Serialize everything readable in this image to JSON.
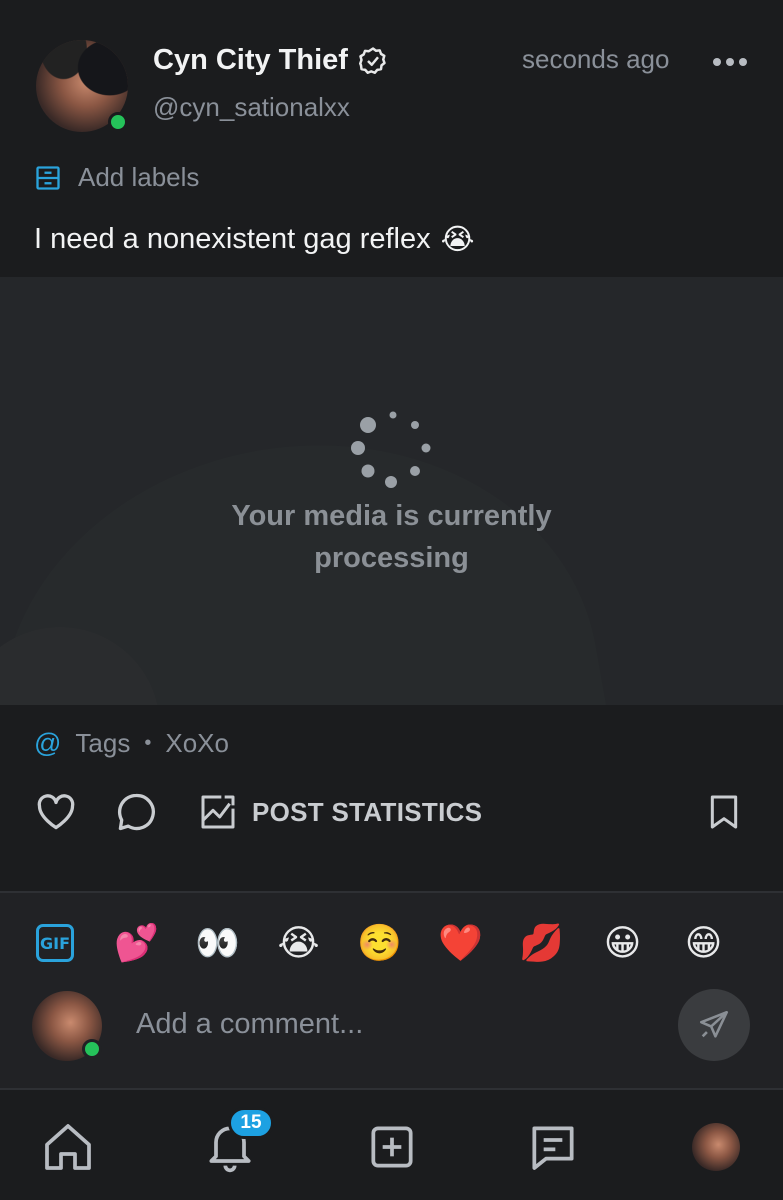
{
  "post": {
    "author": {
      "display_name": "Cyn City Thief",
      "handle": "@cyn_sationalxx",
      "verified_icon": "verified-badge-icon",
      "online": true
    },
    "timestamp": "seconds ago",
    "add_labels": "Add labels",
    "text": "I need a nonexistent gag reflex",
    "text_emoji": "😭",
    "media_status": "Your media is currently processing",
    "tags_label": "Tags",
    "tags_value": "XoXo",
    "post_statistics": "POST STATISTICS"
  },
  "comment_box": {
    "gif_label": "GIF",
    "emojis": [
      "💕",
      "👀",
      "😭",
      "☺️",
      "❤️",
      "💋",
      "😀",
      "😁"
    ],
    "placeholder": "Add a comment..."
  },
  "nav": {
    "notifications_count": "15"
  },
  "colors": {
    "background": "#1b1c1e",
    "accent": "#2aa3dc",
    "online": "#25c25a",
    "badge": "#1da1e2",
    "muted_text": "#8a9099"
  }
}
